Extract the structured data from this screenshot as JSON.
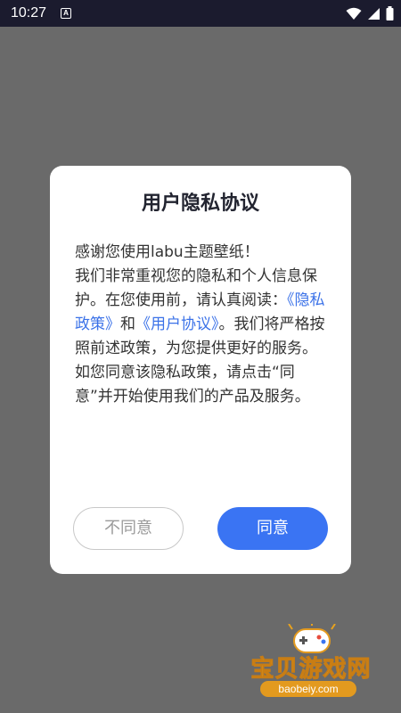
{
  "status_bar": {
    "time": "10:27",
    "notification_icon": "A",
    "icons": [
      "wifi-icon",
      "signal-icon",
      "battery-icon"
    ]
  },
  "dialog": {
    "title": "用户隐私协议",
    "body_line1": "感谢您使用labu主题壁纸！",
    "body_intro": "我们非常重视您的隐私和个人信息保护。在您使用前，请认真阅读：",
    "privacy_link": "《隐私政策》",
    "and_text": "和",
    "user_link": "《用户协议》",
    "body_outro": "。我们将严格按照前述政策，为您提供更好的服务。如您同意该隐私政策，请点击“同意”并开始使用我们的产品及服务。",
    "disagree_label": "不同意",
    "agree_label": "同意"
  },
  "watermark": {
    "title": "宝贝游戏网",
    "domain": "baobeiy.com"
  },
  "colors": {
    "accent": "#3a74f3",
    "link": "#3b72e8",
    "overlay": "#6a6a6a",
    "status_bar": "#1b1b2e"
  }
}
